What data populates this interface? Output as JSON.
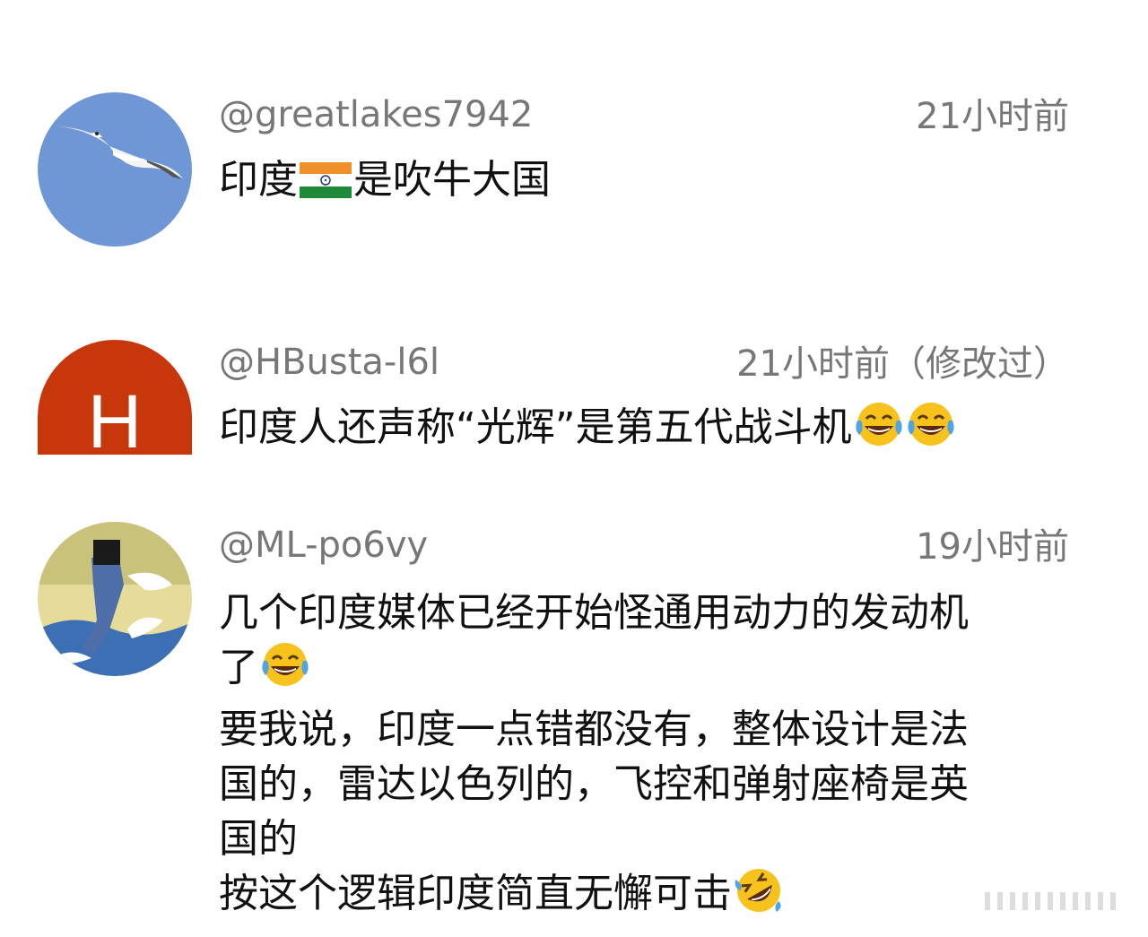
{
  "comments": [
    {
      "username": "@greatlakes7942",
      "timestamp": "21小时前",
      "avatar": "seagull-in-blue-sky",
      "lines": [
        {
          "before": "印度",
          "after": "是吹牛大国"
        }
      ]
    },
    {
      "username": "@HBusta-l6l",
      "timestamp": "21小时前（修改过）",
      "avatar": "letter-h-orange",
      "avatar_letter": "H",
      "lines": [
        {
          "text": "印度人还声称“光辉”是第五代战斗机"
        }
      ]
    },
    {
      "username": "@ML-po6vy",
      "timestamp": "19小时前",
      "avatar": "cartoon-cat-on-wave",
      "lines": [
        {
          "text": "几个印度媒体已经开始怪通用动力的发动机"
        },
        {
          "text": "了"
        },
        {
          "text": "要我说，印度一点错都没有，整体设计是法"
        },
        {
          "text": "国的，雷达以色列的，飞控和弹射座椅是英"
        },
        {
          "text": "国的"
        },
        {
          "text": "按这个逻辑印度简直无懈可击"
        }
      ]
    }
  ],
  "icons": {
    "flag": "india-flag-icon",
    "tears_of_joy": "face-with-tears-of-joy-icon",
    "rolling_laughing": "rolling-on-floor-laughing-icon"
  },
  "colors": {
    "username": "#777777",
    "timestamp": "#777777",
    "text": "#111111",
    "avatar_h_bg": "#c8360c",
    "avatar_sky": "#6f97d6"
  }
}
